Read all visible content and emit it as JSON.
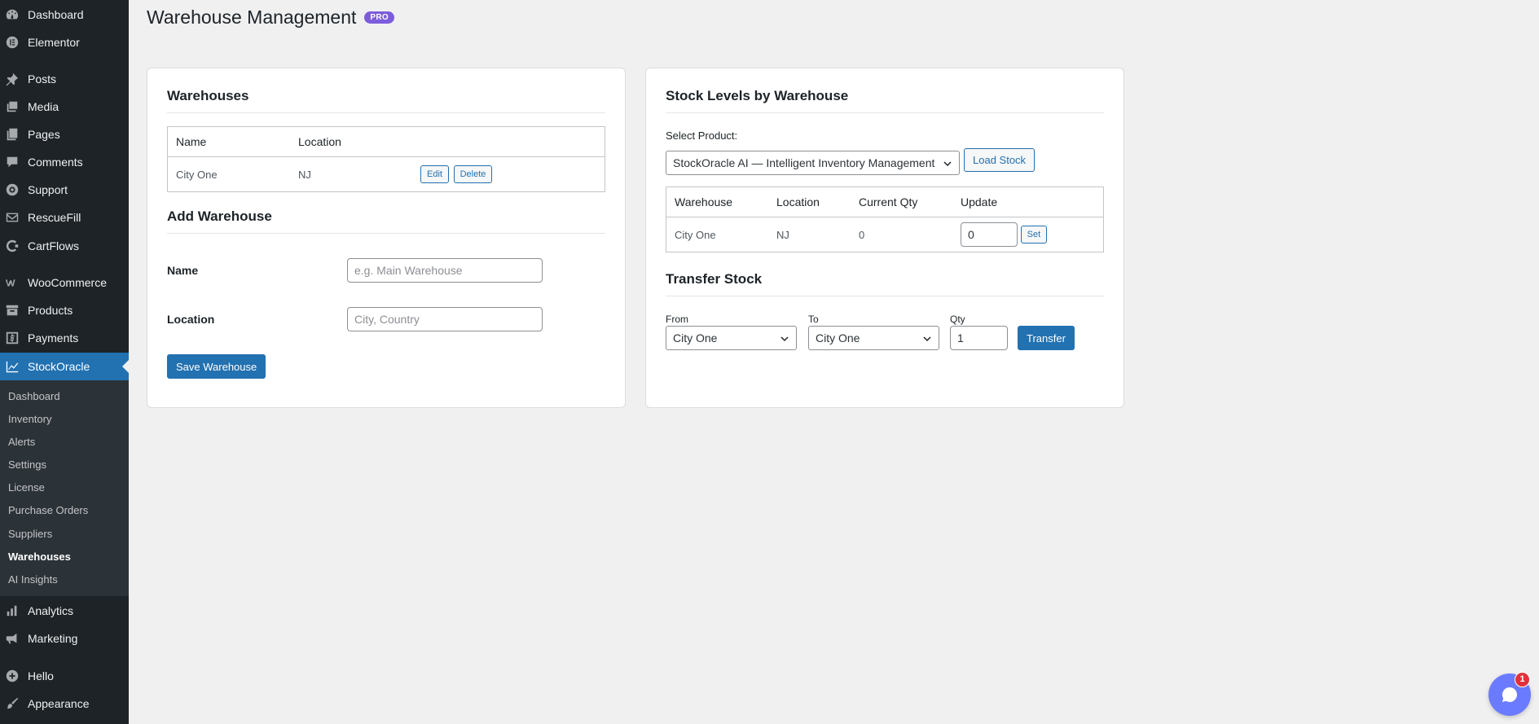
{
  "sidebar": {
    "items": [
      {
        "label": "Dashboard",
        "icon": "dashboard-icon"
      },
      {
        "label": "Elementor",
        "icon": "elementor-icon"
      },
      {
        "label": "Posts",
        "icon": "pin-icon"
      },
      {
        "label": "Media",
        "icon": "media-icon"
      },
      {
        "label": "Pages",
        "icon": "pages-icon"
      },
      {
        "label": "Comments",
        "icon": "comment-icon"
      },
      {
        "label": "Support",
        "icon": "support-icon"
      },
      {
        "label": "RescueFill",
        "icon": "mail-icon"
      },
      {
        "label": "CartFlows",
        "icon": "cartflows-icon"
      },
      {
        "label": "WooCommerce",
        "icon": "woo-icon"
      },
      {
        "label": "Products",
        "icon": "archive-icon"
      },
      {
        "label": "Payments",
        "icon": "dollar-icon"
      },
      {
        "label": "StockOracle",
        "icon": "chart-line-icon"
      },
      {
        "label": "Analytics",
        "icon": "bar-chart-icon"
      },
      {
        "label": "Marketing",
        "icon": "megaphone-icon"
      },
      {
        "label": "Hello",
        "icon": "plus-circle-icon"
      },
      {
        "label": "Appearance",
        "icon": "brush-icon"
      }
    ],
    "submenu": [
      "Dashboard",
      "Inventory",
      "Alerts",
      "Settings",
      "License",
      "Purchase Orders",
      "Suppliers",
      "Warehouses",
      "AI Insights"
    ]
  },
  "header": {
    "title": "Warehouse Management",
    "badge": "PRO"
  },
  "warehouses_card": {
    "title": "Warehouses",
    "columns": [
      "Name",
      "Location"
    ],
    "rows": [
      {
        "name": "City One",
        "location": "NJ"
      }
    ],
    "edit_label": "Edit",
    "delete_label": "Delete",
    "add_title": "Add Warehouse",
    "name_label": "Name",
    "name_placeholder": "e.g. Main Warehouse",
    "location_label": "Location",
    "location_placeholder": "City, Country",
    "save_label": "Save Warehouse"
  },
  "stock_card": {
    "title": "Stock Levels by Warehouse",
    "select_label": "Select Product:",
    "selected_product": "StockOracle AI — Intelligent Inventory Management",
    "load_label": "Load Stock",
    "columns": [
      "Warehouse",
      "Location",
      "Current Qty",
      "Update"
    ],
    "rows": [
      {
        "warehouse": "City One",
        "location": "NJ",
        "qty": "0",
        "update_value": "0"
      }
    ],
    "set_label": "Set",
    "transfer_title": "Transfer Stock",
    "from_label": "From",
    "from_value": "City One",
    "to_label": "To",
    "to_value": "City One",
    "qty_label": "Qty",
    "qty_value": "1",
    "transfer_label": "Transfer"
  },
  "chat": {
    "badge_count": "1"
  }
}
